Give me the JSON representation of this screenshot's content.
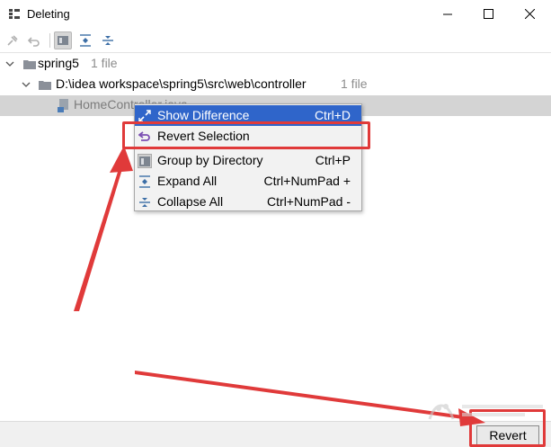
{
  "window": {
    "title": "Deleting",
    "icons": {
      "app": "grid-app-icon",
      "minimize": "minimize-icon",
      "maximize": "maximize-icon",
      "close": "close-icon"
    }
  },
  "toolbar": {
    "buttons": [
      {
        "icon": "pin-icon",
        "active": false
      },
      {
        "icon": "undo-icon",
        "active": false
      },
      {
        "icon": "group-by-directory-icon",
        "active": true
      },
      {
        "icon": "expand-all-icon",
        "active": false
      },
      {
        "icon": "collapse-all-icon",
        "active": false
      }
    ]
  },
  "tree": {
    "nodes": [
      {
        "label": "spring5",
        "count": "1 file",
        "icon": "folder-icon",
        "expanded": true
      },
      {
        "label": "D:\\idea workspace\\spring5\\src\\web\\controller",
        "count": "1 file",
        "icon": "folder-icon",
        "expanded": true
      },
      {
        "label": "HomeController.java",
        "icon": "java-class-icon",
        "selected": true
      }
    ]
  },
  "context_menu": {
    "items": [
      {
        "label": "Show Difference",
        "shortcut": "Ctrl+D",
        "icon": "diff-arrows-icon",
        "highlighted": true
      },
      {
        "label": "Revert Selection",
        "shortcut": "",
        "icon": "revert-icon",
        "highlighted": false
      },
      {
        "label": "Group by Directory",
        "shortcut": "Ctrl+P",
        "icon": "group-by-directory-icon",
        "highlighted": false
      },
      {
        "label": "Expand All",
        "shortcut": "Ctrl+NumPad +",
        "icon": "expand-all-icon",
        "highlighted": false
      },
      {
        "label": "Collapse All",
        "shortcut": "Ctrl+NumPad -",
        "icon": "collapse-all-icon",
        "highlighted": false
      }
    ]
  },
  "footer": {
    "revert_label": "Revert"
  },
  "annotations": {
    "color": "#e03a3a"
  },
  "colors": {
    "menu_highlight": "#2f65ca",
    "selection": "#d4d4d4",
    "muted_text": "#8c8c8c"
  }
}
